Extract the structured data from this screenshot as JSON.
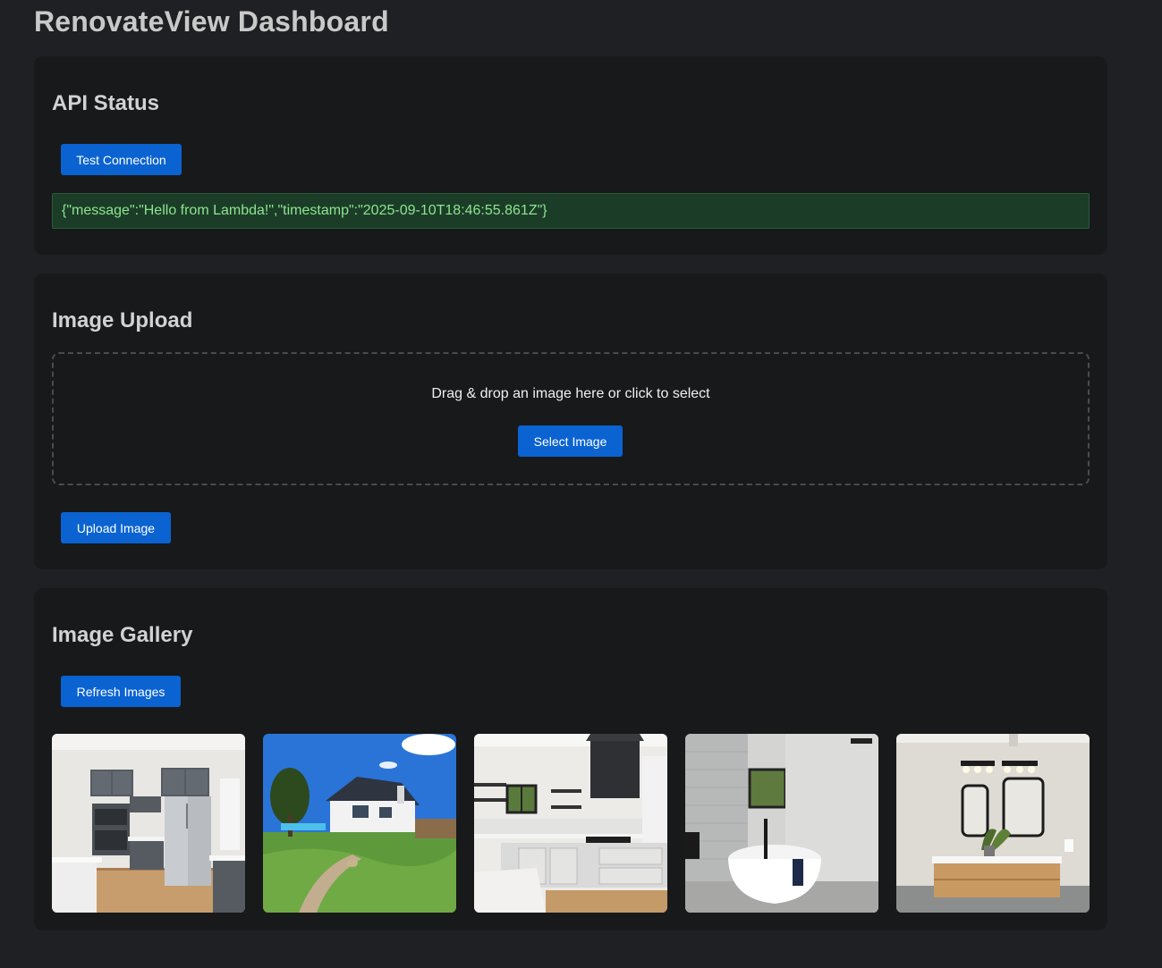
{
  "page": {
    "title": "RenovateView Dashboard"
  },
  "api_status": {
    "heading": "API Status",
    "test_button_label": "Test Connection",
    "response_text": "{\"message\":\"Hello from Lambda!\",\"timestamp\":\"2025-09-10T18:46:55.861Z\"}"
  },
  "image_upload": {
    "heading": "Image Upload",
    "dropzone_text": "Drag & drop an image here or click to select",
    "select_button_label": "Select Image",
    "upload_button_label": "Upload Image"
  },
  "image_gallery": {
    "heading": "Image Gallery",
    "refresh_button_label": "Refresh Images",
    "images": [
      {
        "subject": "kitchen-gray-cabinets"
      },
      {
        "subject": "house-exterior-backyard"
      },
      {
        "subject": "kitchen-white-cabinets"
      },
      {
        "subject": "bathroom-freestanding-tub"
      },
      {
        "subject": "bathroom-double-vanity"
      }
    ]
  },
  "colors": {
    "background": "#1f2023",
    "card": "#18191b",
    "button": "#0a63d1",
    "success_bg": "#1b3d28",
    "success_text": "#8fe38f"
  }
}
